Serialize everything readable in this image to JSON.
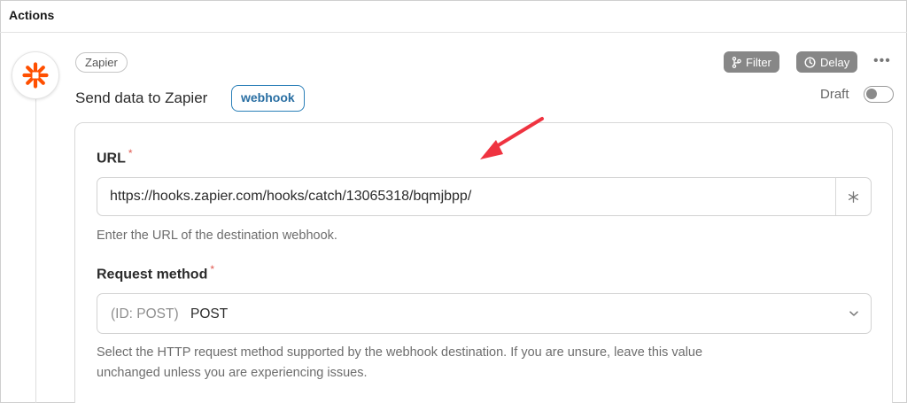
{
  "section": {
    "title": "Actions"
  },
  "action": {
    "app_chip": "Zapier",
    "title": "Send data to Zapier",
    "type_chip": "webhook",
    "logo_icon": "zapier-asterisk-icon",
    "brand_color": "#ff4f00"
  },
  "toolbar": {
    "filter_label": "Filter",
    "delay_label": "Delay",
    "more_label": "•••",
    "draft_label": "Draft",
    "draft_enabled": false
  },
  "form": {
    "url": {
      "label": "URL",
      "required_mark": "*",
      "value": "https://hooks.zapier.com/hooks/catch/13065318/bqmjbpp/",
      "addon_icon": "asterisk-icon",
      "help": "Enter the URL of the destination webhook."
    },
    "method": {
      "label": "Request method",
      "required_mark": "*",
      "prefix": "(ID: POST)",
      "value": "POST",
      "help_line1": "Select the HTTP request method supported by the webhook destination. If you are unsure, leave this value",
      "help_line2": "unchanged unless you are experiencing issues."
    }
  },
  "annotation": {
    "arrow_color": "#ef3340"
  }
}
